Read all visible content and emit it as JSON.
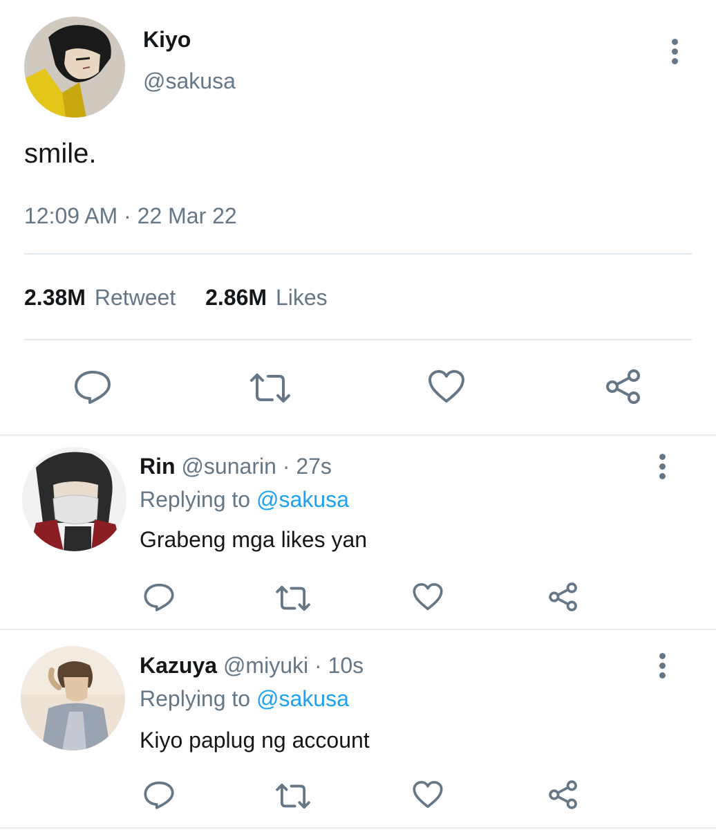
{
  "tweet": {
    "author_name": "Kiyo",
    "author_handle": "@sakusa",
    "text": "smile.",
    "timestamp": "12:09 AM · 22 Mar 22",
    "retweets_count": "2.38M",
    "retweets_label": "Retweet",
    "likes_count": "2.86M",
    "likes_label": "Likes"
  },
  "replies": [
    {
      "name": "Rin",
      "handle": "@sunarin",
      "time": "· 27s",
      "replying_prefix": "Replying to",
      "replying_handle": "@sakusa",
      "text": "Grabeng mga likes yan"
    },
    {
      "name": "Kazuya",
      "handle": "@miyuki",
      "time": "· 10s",
      "replying_prefix": "Replying to",
      "replying_handle": "@sakusa",
      "text": "Kiyo paplug ng account"
    }
  ],
  "icons": [
    "more-vertical-icon",
    "reply-icon",
    "retweet-icon",
    "like-icon",
    "share-icon"
  ],
  "colors": {
    "text": "#14171a",
    "secondary": "#657786",
    "accent": "#1da1f2",
    "divider": "#e1e8ed"
  }
}
